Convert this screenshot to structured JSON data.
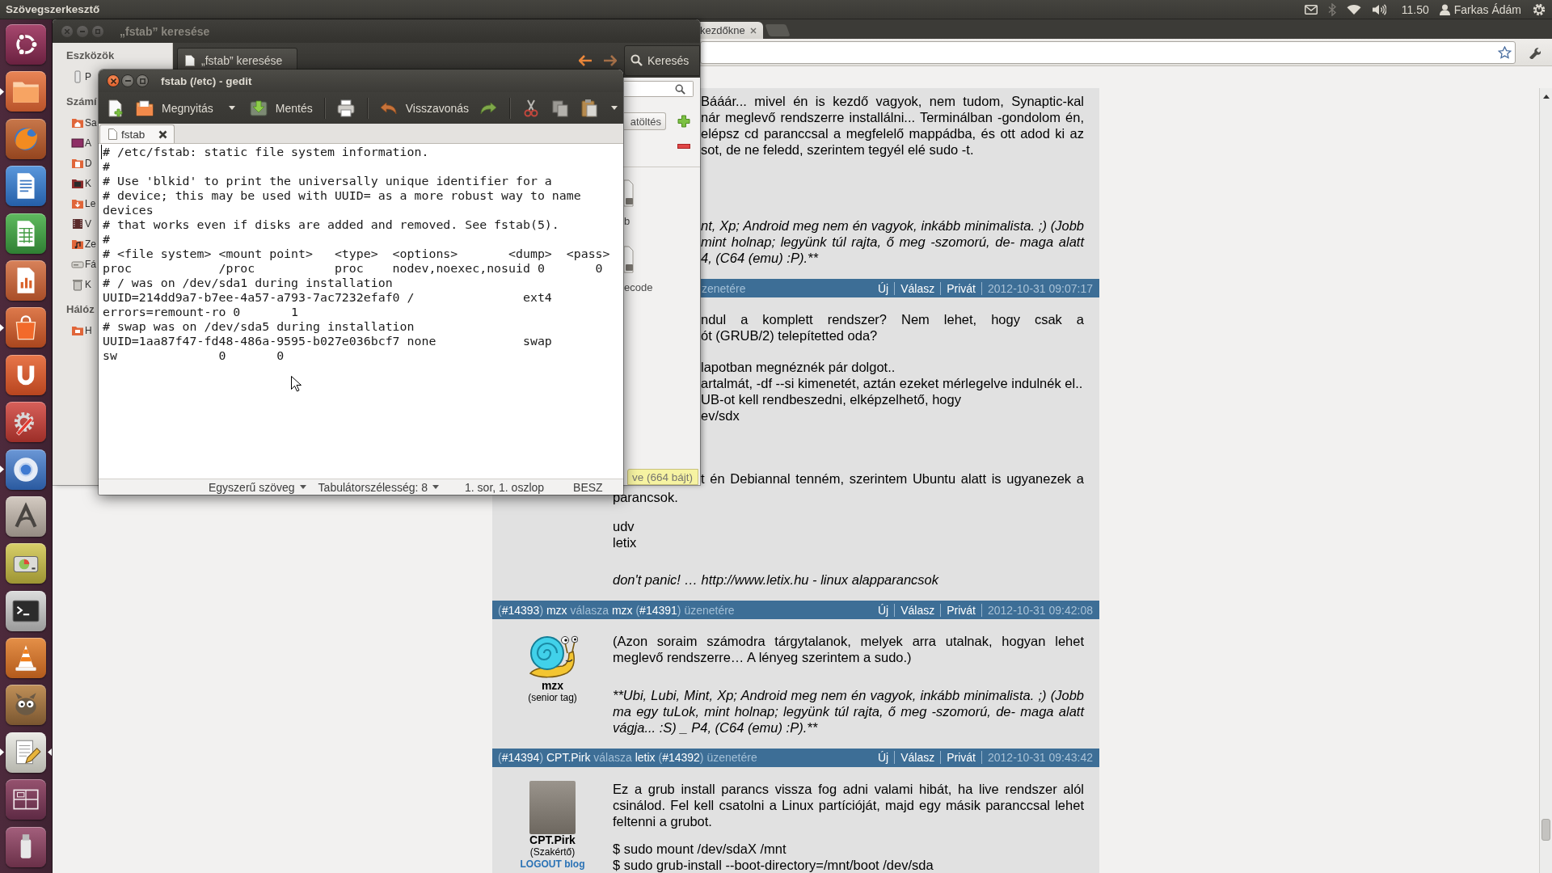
{
  "top_panel": {
    "app_title": "Szövegszerkesztő",
    "clock": "11.50",
    "user": "Farkas Ádám"
  },
  "launcher": [
    {
      "kind": "home",
      "running": false,
      "focused": false
    },
    {
      "kind": "folder",
      "running": true,
      "focused": false
    },
    {
      "kind": "browser",
      "running": false,
      "focused": false
    },
    {
      "kind": "writer",
      "running": false,
      "focused": false
    },
    {
      "kind": "sheet",
      "running": false,
      "focused": false
    },
    {
      "kind": "slides",
      "running": false,
      "focused": false
    },
    {
      "kind": "bag",
      "running": true,
      "focused": false
    },
    {
      "kind": "cloud",
      "running": false,
      "focused": false
    },
    {
      "kind": "settings",
      "running": false,
      "focused": false
    },
    {
      "kind": "globe",
      "running": true,
      "focused": false
    },
    {
      "kind": "pen",
      "running": false,
      "focused": false
    },
    {
      "kind": "drive",
      "running": false,
      "focused": false
    },
    {
      "kind": "terminal",
      "running": false,
      "focused": false
    },
    {
      "kind": "cone",
      "running": false,
      "focused": false
    },
    {
      "kind": "mascot",
      "running": false,
      "focused": false
    },
    {
      "kind": "editor",
      "running": true,
      "focused": true
    },
    {
      "kind": "workspaces",
      "running": false,
      "focused": false
    },
    {
      "kind": "usb",
      "running": false,
      "focused": false
    }
  ],
  "browser": {
    "tab_title": "kezdőkne",
    "posts": [
      {
        "blocks": [
          {
            "kind": "clip",
            "italic": false,
            "text": "Bááár... mivel én is kezdő vagyok, nem tudom, Synaptic-kal"
          },
          {
            "kind": "clip",
            "italic": false,
            "text": "nár meglevő rendszerre installálni... Terminálban -gondolom én,"
          },
          {
            "kind": "clip",
            "italic": false,
            "text": "elépsz cd paranccsal a megfelelő mappádba, és ott adod ki az"
          },
          {
            "kind": "clipend",
            "italic": false,
            "text": "sot, de ne feledd, szerintem tegyél elé sudo -t."
          },
          {
            "kind": "clip",
            "italic": true,
            "text": "nt, Xp; Android meg nem én vagyok, inkább minimalista. ;) (Jobb"
          },
          {
            "kind": "clip",
            "italic": true,
            "text": "mint holnap; legyünk túl rajta, ő meg -szomorú, de- maga alatt"
          },
          {
            "kind": "clipend",
            "italic": true,
            "text": "4, (C64 (emu) :P).**"
          }
        ]
      },
      {
        "header": {
          "kind": "clipped",
          "title": [
            {
              "kind": "plain",
              "text": "zenetére"
            }
          ],
          "actions": [
            "Új",
            "Válasz",
            "Privát"
          ],
          "date": "2012-10-31 09:07:17"
        },
        "blocks": [
          {
            "kind": "clip",
            "italic": false,
            "text": "ndul a komplett rendszer? Nem lehet, hogy csak a"
          },
          {
            "kind": "clipend",
            "italic": false,
            "text": "ót (GRUB/2) telepítetted oda?"
          },
          {
            "kind": "clipend",
            "italic": false,
            "text": "lapotban megnéznék pár dolgot.."
          },
          {
            "kind": "clipend",
            "italic": false,
            "text": "artalmát, -df --si kimenetét, aztán ezeket mérlegelve indulnék el.."
          },
          {
            "kind": "clipend",
            "italic": false,
            "text": "UB-ot kell rendbeszedni, elképzelhető, hogy"
          },
          {
            "kind": "clipend",
            "italic": false,
            "text": "ev/sdx"
          },
          {
            "kind": "clip",
            "italic": false,
            "text": "t én Debiannal tenném, szerintem Ubuntu alatt is ugyanezek a"
          },
          {
            "kind": "line",
            "italic": false,
            "text": "parancsok."
          },
          {
            "kind": "line",
            "italic": false,
            "text": "udv"
          },
          {
            "kind": "line",
            "italic": false,
            "text": "letix"
          },
          {
            "kind": "line",
            "italic": true,
            "text": "don't panic! … http://www.letix.hu - linux alapparancsok"
          }
        ]
      },
      {
        "header": {
          "kind": "full",
          "title": [
            {
              "kind": "plain",
              "text": "("
            },
            {
              "kind": "link",
              "text": "#14393"
            },
            {
              "kind": "plain",
              "text": ") "
            },
            {
              "kind": "link",
              "text": "mzx"
            },
            {
              "kind": "plain",
              "text": " válasza "
            },
            {
              "kind": "link",
              "text": "mzx"
            },
            {
              "kind": "plain",
              "text": " ("
            },
            {
              "kind": "link",
              "text": "#14391"
            },
            {
              "kind": "plain",
              "text": ") üzenetére"
            }
          ],
          "actions": [
            "Új",
            "Válasz",
            "Privát"
          ],
          "date": "2012-10-31 09:42:08"
        },
        "author": {
          "kind": "snail",
          "name": "mzx",
          "rank": "(senior tag)"
        },
        "blocks": [
          {
            "kind": "para",
            "italic": false,
            "text": "(Azon soraim számodra tárgytalanok, melyek arra utalnak, hogyan lehet meglevő rendszerre… A lényeg szerintem a sudo.)"
          },
          {
            "kind": "para",
            "italic": true,
            "text": "**Ubi, Lubi, Mint, Xp; Android meg nem én vagyok, inkább minimalista. ;) (Jobb ma egy tuLok, mint holnap; legyünk túl rajta, ő meg -szomorú, de- maga alatt vágja... :S) _ P4, (C64 (emu) :P).**"
          }
        ]
      },
      {
        "header": {
          "kind": "full",
          "title": [
            {
              "kind": "plain",
              "text": "("
            },
            {
              "kind": "link",
              "text": "#14394"
            },
            {
              "kind": "plain",
              "text": ") "
            },
            {
              "kind": "link",
              "text": "CPT.Pirk"
            },
            {
              "kind": "plain",
              "text": " válasza "
            },
            {
              "kind": "link",
              "text": "letix"
            },
            {
              "kind": "plain",
              "text": " ("
            },
            {
              "kind": "link",
              "text": "#14392"
            },
            {
              "kind": "plain",
              "text": ") üzenetére"
            }
          ],
          "actions": [
            "Új",
            "Válasz",
            "Privát"
          ],
          "date": "2012-10-31 09:43:42"
        },
        "author": {
          "kind": "photo",
          "name": "CPT.Pirk",
          "rank": "(Szakértő)",
          "link": "LOGOUT blog"
        },
        "blocks": [
          {
            "kind": "para",
            "italic": false,
            "text": "Ez a grub install parancs vissza fog adni valami hibát, ha live rendszer alól csinálod. Fel kell csatolni a Linux partícióját, majd egy másik paranccsal lehet feltenni a grubot."
          },
          {
            "kind": "line",
            "italic": false,
            "text": "$ sudo mount /dev/sdaX /mnt"
          },
          {
            "kind": "line",
            "italic": false,
            "text": "$ sudo grub-install --boot-directory=/mnt/boot /dev/sda"
          }
        ]
      }
    ]
  },
  "search_window": {
    "title": "„fstab” keresése",
    "path_button": "„fstab” keresése",
    "search_button": "Keresés",
    "sidebar": [
      {
        "title": "Eszközök",
        "items": [
          {
            "kind": "phone",
            "label": "P"
          }
        ]
      },
      {
        "title": "Számí",
        "items": [
          {
            "kind": "home",
            "label": "Sa"
          },
          {
            "kind": "desktop",
            "label": "A"
          },
          {
            "kind": "documents",
            "label": "D"
          },
          {
            "kind": "pictures",
            "label": "K"
          },
          {
            "kind": "downloads",
            "label": "Le"
          },
          {
            "kind": "videos",
            "label": "V"
          },
          {
            "kind": "music",
            "label": "Ze"
          },
          {
            "kind": "drive",
            "label": "Fá"
          },
          {
            "kind": "trash",
            "label": "K"
          }
        ]
      },
      {
        "title": "Hálóz",
        "items": [
          {
            "kind": "network",
            "label": "H"
          }
        ]
      }
    ],
    "reload_button": "atöltés",
    "files": [
      {
        "name": "b"
      },
      {
        "name": "ecode"
      }
    ],
    "status": "ve (664 bájt)"
  },
  "editor": {
    "title": "fstab (/etc) - gedit",
    "toolbar": [
      {
        "kind": "new"
      },
      {
        "kind": "open",
        "label": "Megnyitás"
      },
      {
        "kind": "menu"
      },
      {
        "kind": "save",
        "label": "Mentés"
      },
      {
        "kind": "separator"
      },
      {
        "kind": "print"
      },
      {
        "kind": "separator"
      },
      {
        "kind": "undo",
        "label": "Visszavonás"
      },
      {
        "kind": "redo"
      },
      {
        "kind": "separator"
      },
      {
        "kind": "cut"
      },
      {
        "kind": "copy"
      },
      {
        "kind": "paste"
      },
      {
        "kind": "more"
      }
    ],
    "tab": "fstab",
    "lines": [
      "# /etc/fstab: static file system information.",
      "#",
      "# Use 'blkid' to print the universally unique identifier for a",
      "# device; this may be used with UUID= as a more robust way to name",
      "devices",
      "# that works even if disks are added and removed. See fstab(5).",
      "#",
      "# <file system> <mount point>   <type>  <options>       <dump>  <pass>",
      "proc            /proc           proc    nodev,noexec,nosuid 0       0",
      "# / was on /dev/sda1 during installation",
      "UUID=214dd9a7-b7ee-4a57-a793-7ac7232efaf0 /               ext4",
      "errors=remount-ro 0       1",
      "# swap was on /dev/sda5 during installation",
      "UUID=1aa87f47-fd48-486a-9595-b027e036bcf7 none            swap",
      "sw              0       0"
    ],
    "status": {
      "language": "Egyszerű szöveg",
      "tab_width": "Tabulátorszélesség: 8",
      "position": "1. sor, 1. oszlop",
      "mode": "BESZ"
    }
  }
}
